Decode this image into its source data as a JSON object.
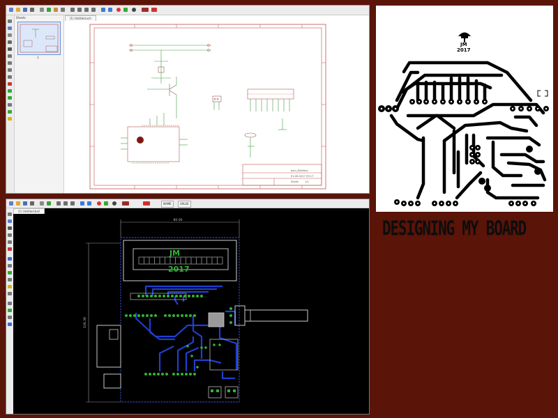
{
  "schematic_window": {
    "sheets_label": "Sheets",
    "sheet_number": "1",
    "document_tab": "(1) Untitled.sch",
    "title_block": {
      "name": "Jean_Molliano",
      "date": "01-06-2017 09:17",
      "sheet_label": "Sheet:",
      "sheet_value": "1/1"
    }
  },
  "board_window": {
    "document_tab": "(1) Untitled.brd",
    "toolbar_buttons": [
      "NAME",
      "VALUE"
    ],
    "silkscreen_initials": "JM",
    "silkscreen_year": "2017",
    "dimension_width": "80.00",
    "dimension_height": "106.38"
  },
  "pcb_preview": {
    "logo_initials": "JM",
    "logo_year": "2017"
  },
  "caption": "DESIGNING MY BOARD",
  "colors": {
    "background": "#5a1408",
    "frame_red": "#c0504d",
    "trace_blue": "#1f3fd0",
    "pad_green": "#33b233",
    "silk_gray": "#c8c8c8"
  }
}
